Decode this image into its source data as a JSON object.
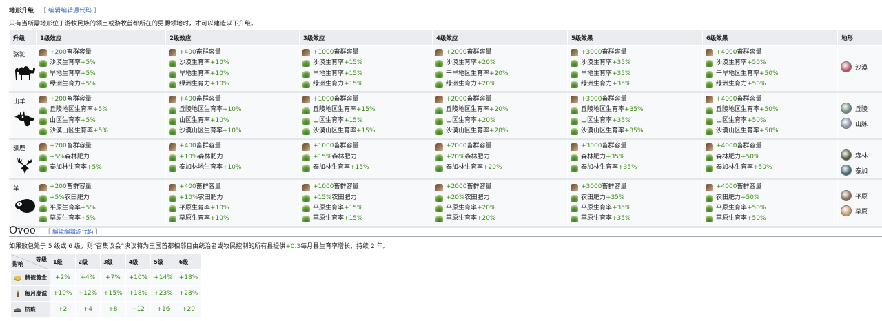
{
  "section1": {
    "title": "地形升级",
    "edit_open": "［",
    "edit_label": "编辑编辑源代码",
    "edit_close": "］",
    "intro": "只有当所需地形位于游牧民族的领土或游牧首都所在的男爵领地时，才可以建造以下升级。"
  },
  "headers": [
    "升级",
    "1级效应",
    "2级效应",
    "3级效应",
    "4级效应",
    "5级效果",
    "6级效果",
    "地形"
  ],
  "rows": [
    {
      "name": "骆驼",
      "icon": "camel-icon",
      "levels": [
        [
          {
            "n": "+200",
            "t": "畜群容量",
            "p": "pre"
          },
          {
            "t": "沙漠生育率",
            "n": "+5%",
            "p": "post"
          },
          {
            "t": "旱地生育率",
            "n": "+5%",
            "p": "post"
          },
          {
            "t": "绿洲生育力",
            "n": "+5%",
            "p": "post"
          }
        ],
        [
          {
            "n": "+400",
            "t": "畜群容量",
            "p": "pre"
          },
          {
            "t": "沙漠生育率",
            "n": "+10%",
            "p": "post"
          },
          {
            "t": "旱地生育率",
            "n": "+10%",
            "p": "post"
          },
          {
            "t": "绿洲生育力",
            "n": "+10%",
            "p": "post"
          }
        ],
        [
          {
            "n": "+1000",
            "t": "畜群容量",
            "p": "pre"
          },
          {
            "t": "沙漠生育率",
            "n": "+15%",
            "p": "post"
          },
          {
            "t": "旱地生育率",
            "n": "+15%",
            "p": "post"
          },
          {
            "t": "绿洲生育力",
            "n": "+15%",
            "p": "post"
          }
        ],
        [
          {
            "n": "+2000",
            "t": "畜群容量",
            "p": "pre"
          },
          {
            "t": "沙漠生育率",
            "n": "+20%",
            "p": "post"
          },
          {
            "t": "干旱地区生育率",
            "n": "+20%",
            "p": "post"
          },
          {
            "t": "绿洲生育力",
            "n": "+20%",
            "p": "post"
          }
        ],
        [
          {
            "n": "+3000",
            "t": "畜群容量",
            "p": "pre"
          },
          {
            "t": "沙漠生育率",
            "n": "+35%",
            "p": "post"
          },
          {
            "t": "旱地生育率",
            "n": "+35%",
            "p": "post"
          },
          {
            "t": "绿洲生育力",
            "n": "+35%",
            "p": "post"
          }
        ],
        [
          {
            "n": "+4000",
            "t": "畜群容量",
            "p": "pre"
          },
          {
            "t": "沙漠生育率",
            "n": "+50%",
            "p": "post"
          },
          {
            "t": "干旱地区生育率",
            "n": "+50%",
            "p": "post"
          },
          {
            "t": "绿洲生育力",
            "n": "+50%",
            "p": "post"
          }
        ]
      ],
      "terrain": [
        {
          "label": "沙漠",
          "color": "#b8536a"
        }
      ]
    },
    {
      "name": "山羊",
      "icon": "goat-icon",
      "levels": [
        [
          {
            "n": "+200",
            "t": "畜群容量",
            "p": "pre"
          },
          {
            "t": "丘陵地区生育率",
            "n": "+5%",
            "p": "post"
          },
          {
            "t": "山区生育率",
            "n": "+5%",
            "p": "post"
          },
          {
            "t": "沙漠山区生育率",
            "n": "+5%",
            "p": "post"
          }
        ],
        [
          {
            "n": "+400",
            "t": "畜群容量",
            "p": "pre"
          },
          {
            "t": "丘陵地区生育率",
            "n": "+10%",
            "p": "post"
          },
          {
            "t": "山区生育率",
            "n": "+10%",
            "p": "post"
          },
          {
            "t": "沙漠山区生育率",
            "n": "+10%",
            "p": "post"
          }
        ],
        [
          {
            "n": "+1000",
            "t": "畜群容量",
            "p": "pre"
          },
          {
            "t": "丘陵地区生育率",
            "n": "+15%",
            "p": "post"
          },
          {
            "t": "山区生育率",
            "n": "+15%",
            "p": "post"
          },
          {
            "t": "沙漠山区生育率",
            "n": "+15%",
            "p": "post"
          }
        ],
        [
          {
            "n": "+2000",
            "t": "畜群容量",
            "p": "pre"
          },
          {
            "t": "丘陵地区生育率",
            "n": "+20%",
            "p": "post"
          },
          {
            "t": "山区生育率",
            "n": "+20%",
            "p": "post"
          },
          {
            "t": "沙漠山区生育率",
            "n": "+20%",
            "p": "post"
          }
        ],
        [
          {
            "n": "+3000",
            "t": "畜群容量",
            "p": "pre"
          },
          {
            "t": "丘陵地区生育率",
            "n": "+35%",
            "p": "post"
          },
          {
            "t": "山区生育率",
            "n": "+35%",
            "p": "post"
          },
          {
            "t": "沙漠山区生育率",
            "n": "+35%",
            "p": "post"
          }
        ],
        [
          {
            "n": "+4000",
            "t": "畜群容量",
            "p": "pre"
          },
          {
            "t": "丘陵地区生育率",
            "n": "+50%",
            "p": "post"
          },
          {
            "t": "山区生育率",
            "n": "+50%",
            "p": "post"
          },
          {
            "t": "沙漠山区生育率",
            "n": "+50%",
            "p": "post"
          }
        ]
      ],
      "terrain": [
        {
          "label": "丘陵",
          "color": "#6b8a78"
        },
        {
          "label": "山脉",
          "color": "#8a93a6"
        }
      ]
    },
    {
      "name": "驯鹿",
      "icon": "reindeer-icon",
      "levels": [
        [
          {
            "n": "+200",
            "t": "畜群容量",
            "p": "pre"
          },
          {
            "n": "+5%",
            "t": "森林肥力",
            "p": "pre"
          },
          {
            "t": "泰加林生育率",
            "n": "+5%",
            "p": "post"
          }
        ],
        [
          {
            "n": "+400",
            "t": "畜群容量",
            "p": "pre"
          },
          {
            "n": "+10%",
            "t": "森林肥力",
            "p": "pre"
          },
          {
            "t": "泰加林地生育率",
            "n": "+10%",
            "p": "post"
          }
        ],
        [
          {
            "n": "+1000",
            "t": "畜群容量",
            "p": "pre"
          },
          {
            "n": "+15%",
            "t": "森林肥力",
            "p": "pre"
          },
          {
            "t": "泰加林生育率",
            "n": "+15%",
            "p": "post"
          }
        ],
        [
          {
            "n": "+2000",
            "t": "畜群容量",
            "p": "pre"
          },
          {
            "n": "+20%",
            "t": "森林肥力",
            "p": "pre"
          },
          {
            "t": "泰加林生育率",
            "n": "+20%",
            "p": "post"
          }
        ],
        [
          {
            "n": "+3000",
            "t": "畜群容量",
            "p": "pre"
          },
          {
            "t": "森林肥力",
            "n": "+35%",
            "p": "post"
          },
          {
            "t": "泰加林生育率",
            "n": "+35%",
            "p": "post"
          }
        ],
        [
          {
            "n": "+4000",
            "t": "畜群容量",
            "p": "pre"
          },
          {
            "t": "森林肥力",
            "n": "+50%",
            "p": "post"
          },
          {
            "t": "泰加林生育率",
            "n": "+50%",
            "p": "post"
          }
        ]
      ],
      "terrain": [
        {
          "label": "森林",
          "color": "#4d5e3a"
        },
        {
          "label": "泰加",
          "color": "#3f6470"
        }
      ]
    },
    {
      "name": "羊",
      "icon": "sheep-icon",
      "levels": [
        [
          {
            "n": "+200",
            "t": "畜群容量",
            "p": "pre"
          },
          {
            "n": "+5%",
            "t": "农田肥力",
            "p": "pre"
          },
          {
            "t": "平原生育率",
            "n": "+5%",
            "p": "post"
          },
          {
            "t": "草原生育率",
            "n": "+5%",
            "p": "post"
          }
        ],
        [
          {
            "n": "+400",
            "t": "畜群容量",
            "p": "pre"
          },
          {
            "n": "+10%",
            "t": "农田肥力",
            "p": "pre"
          },
          {
            "t": "平原生育率",
            "n": "+10%",
            "p": "post"
          },
          {
            "t": "草原生育率",
            "n": "+10%",
            "p": "post"
          }
        ],
        [
          {
            "n": "+1000",
            "t": "畜群容量",
            "p": "pre"
          },
          {
            "n": "+15%",
            "t": "农田肥力",
            "p": "pre"
          },
          {
            "t": "平原生育率",
            "n": "+15%",
            "p": "post"
          },
          {
            "t": "草原生育率",
            "n": "+15%",
            "p": "post"
          }
        ],
        [
          {
            "n": "+2000",
            "t": "畜群容量",
            "p": "pre"
          },
          {
            "n": "+20%",
            "t": "农田肥力",
            "p": "pre"
          },
          {
            "t": "平原生育率",
            "n": "+20%",
            "p": "post"
          },
          {
            "t": "草原生育率",
            "n": "+20%",
            "p": "post"
          }
        ],
        [
          {
            "n": "+3000",
            "t": "畜群容量",
            "p": "pre"
          },
          {
            "t": "农田肥力",
            "n": "+35%",
            "p": "post"
          },
          {
            "t": "平原生育率",
            "n": "+35%",
            "p": "post"
          },
          {
            "t": "草原生育率",
            "n": "+35%",
            "p": "post"
          }
        ],
        [
          {
            "n": "+4000",
            "t": "畜群容量",
            "p": "pre"
          },
          {
            "t": "农田肥力",
            "n": "+50%",
            "p": "post"
          },
          {
            "t": "平原生育率",
            "n": "+50%",
            "p": "post"
          },
          {
            "t": "草原生育率",
            "n": "+50%",
            "p": "post"
          }
        ]
      ],
      "terrain": [
        {
          "label": "平原",
          "color": "#8a6a4e"
        },
        {
          "label": "草原",
          "color": "#c49a6c"
        }
      ]
    }
  ],
  "section2": {
    "title": "Ovoo",
    "edit_open": "［",
    "edit_label": "编辑编辑源代码",
    "edit_close": "］",
    "desc_a": "如果敖包处于 5 级或 6 级，则“召集议会”决议将为王国首都相邻且由统治者或牧民控制的所有县提供",
    "desc_value": "+0.3",
    "desc_b": "每月县生育率增长，持续 2 年。"
  },
  "ovoo": {
    "corner_top": "等级",
    "corner_bottom": "影响",
    "levels": [
      "1级",
      "2级",
      "3级",
      "4级",
      "5级",
      "6级"
    ],
    "rows": [
      {
        "label": "赫德黄金",
        "icon": "gold-icon",
        "values": [
          "+2%",
          "+4%",
          "+7%",
          "+10%",
          "+14%",
          "+18%"
        ]
      },
      {
        "label": "每月虔诚",
        "icon": "piety-icon",
        "values": [
          "+10%",
          "+12%",
          "+15%",
          "+18%",
          "+23%",
          "+28%"
        ]
      },
      {
        "label": "抗疫",
        "icon": "helmet-icon",
        "values": [
          "+2",
          "+4",
          "+8",
          "+12",
          "+16",
          "+20"
        ]
      }
    ]
  },
  "colors": {
    "positive": "#3a8a12",
    "link": "#3366cc"
  }
}
